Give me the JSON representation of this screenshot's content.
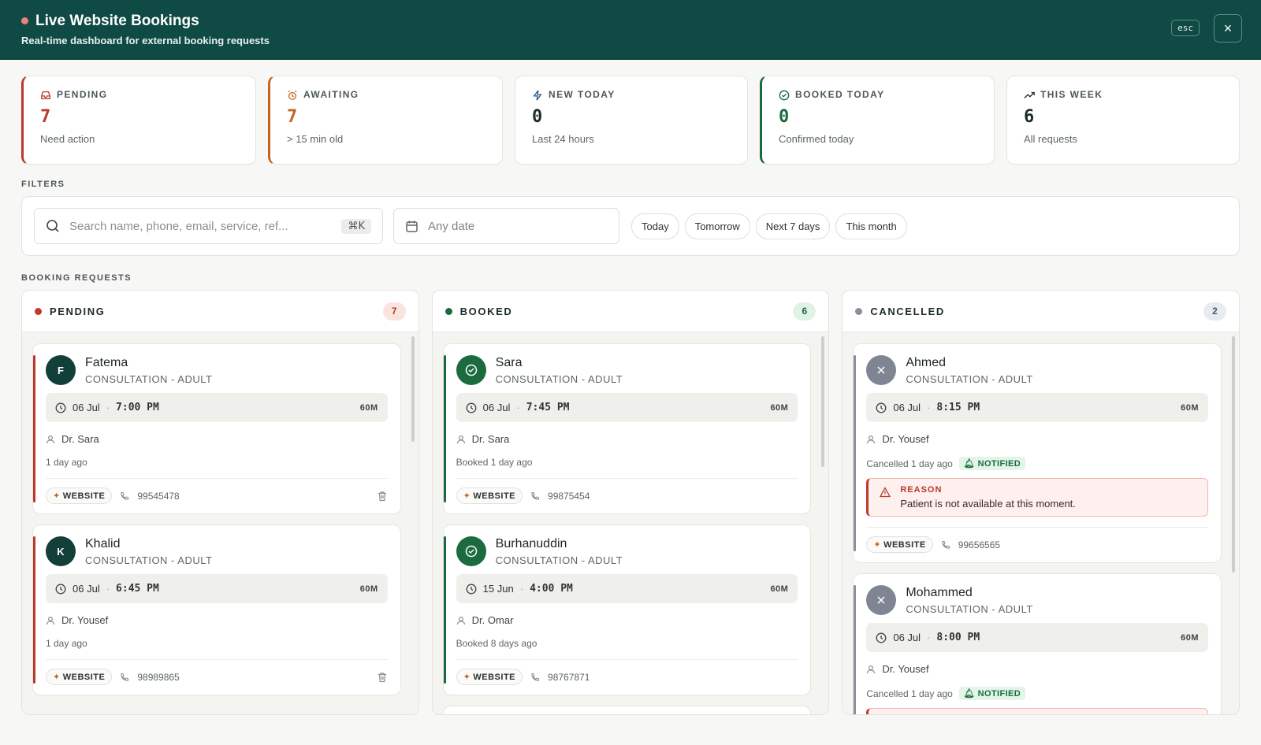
{
  "header": {
    "title": "Live Website Bookings",
    "subtitle": "Real-time dashboard for external booking requests",
    "esc_label": "esc",
    "close_label": "×"
  },
  "stats": [
    {
      "label": "PENDING",
      "value": "7",
      "sub": "Need action",
      "icon": "inbox-icon",
      "color": "#b83a2a"
    },
    {
      "label": "AWAITING",
      "value": "7",
      "sub": "> 15 min old",
      "icon": "alarm-icon",
      "color": "#c4651c"
    },
    {
      "label": "NEW TODAY",
      "value": "0",
      "sub": "Last 24 hours",
      "icon": "bolt-icon",
      "color": "#2a5a8a"
    },
    {
      "label": "BOOKED TODAY",
      "value": "0",
      "sub": "Confirmed today",
      "icon": "check-circle-icon",
      "color": "#1b6b3e"
    },
    {
      "label": "THIS WEEK",
      "value": "6",
      "sub": "All requests",
      "icon": "trend-up-icon",
      "color": "#1f2a2a"
    }
  ],
  "filters": {
    "section_label": "FILTERS",
    "search_placeholder": "Search name, phone, email, service, ref...",
    "shortcut": "⌘K",
    "date_placeholder": "Any date",
    "chips": [
      "Today",
      "Tomorrow",
      "Next 7 days",
      "This month"
    ]
  },
  "requests": {
    "section_label": "BOOKING REQUESTS",
    "columns": [
      {
        "title": "PENDING",
        "count": "7",
        "dot": "#c0392b",
        "count_bg": "#fbe3df",
        "count_fg": "#b83a2a",
        "cards": [
          {
            "initial": "F",
            "name": "Fatema",
            "service": "CONSULTATION - ADULT",
            "date": "06 Jul",
            "time": "7:00 PM",
            "duration": "60M",
            "doctor": "Dr. Sara",
            "ago": "1 day ago",
            "source": "WEBSITE",
            "phone": "99545478"
          },
          {
            "initial": "K",
            "name": "Khalid",
            "service": "CONSULTATION - ADULT",
            "date": "06 Jul",
            "time": "6:45 PM",
            "duration": "60M",
            "doctor": "Dr. Yousef",
            "ago": "1 day ago",
            "source": "WEBSITE",
            "phone": "98989865"
          }
        ]
      },
      {
        "title": "BOOKED",
        "count": "6",
        "dot": "#1b6b3e",
        "count_bg": "#dff2e5",
        "count_fg": "#1b6b3e",
        "cards": [
          {
            "name": "Sara",
            "service": "CONSULTATION - ADULT",
            "date": "06 Jul",
            "time": "7:45 PM",
            "duration": "60M",
            "doctor": "Dr. Sara",
            "ago": "Booked 1 day ago",
            "source": "WEBSITE",
            "phone": "99875454"
          },
          {
            "name": "Burhanuddin",
            "service": "CONSULTATION - ADULT",
            "date": "15 Jun",
            "time": "4:00 PM",
            "duration": "60M",
            "doctor": "Dr. Omar",
            "ago": "Booked 8 days ago",
            "source": "WEBSITE",
            "phone": "98767871"
          }
        ]
      },
      {
        "title": "CANCELLED",
        "count": "2",
        "dot": "#8a8f99",
        "count_bg": "#e8ebf0",
        "count_fg": "#4d5566",
        "cards": [
          {
            "name": "Ahmed",
            "service": "CONSULTATION - ADULT",
            "date": "06 Jul",
            "time": "8:15 PM",
            "duration": "60M",
            "doctor": "Dr. Yousef",
            "ago": "Cancelled 1 day ago",
            "notified": "NOTIFIED",
            "reason_label": "REASON",
            "reason": "Patient is not available at this moment.",
            "source": "WEBSITE",
            "phone": "99656565"
          },
          {
            "name": "Mohammed",
            "service": "CONSULTATION - ADULT",
            "date": "06 Jul",
            "time": "8:00 PM",
            "duration": "60M",
            "doctor": "Dr. Yousef",
            "ago": "Cancelled 1 day ago",
            "notified": "NOTIFIED"
          }
        ]
      }
    ]
  }
}
